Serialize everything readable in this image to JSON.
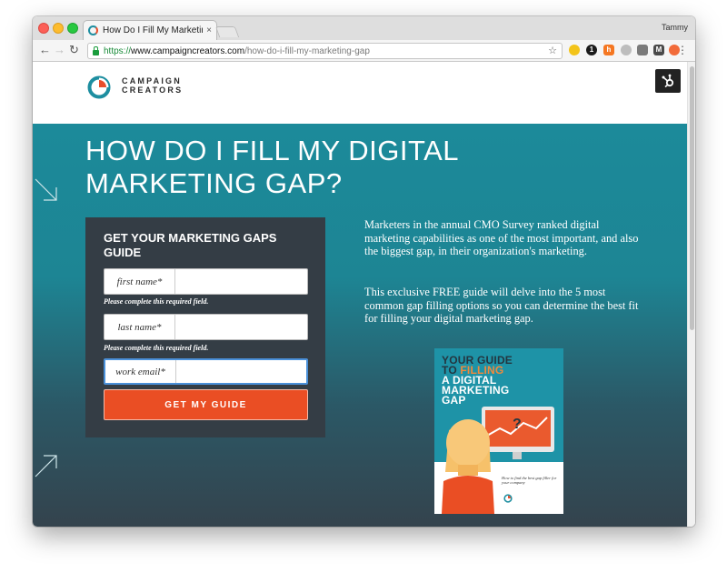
{
  "browser": {
    "tab_title": "How Do I Fill My Marketing Gap",
    "tab_close": "×",
    "profile_name": "Tammy",
    "url_scheme": "https://",
    "url_host": "www.campaigncreators.com",
    "url_path": "/how-do-i-fill-my-marketing-gap",
    "extension_icons": [
      "emoji-icon",
      "one-password-icon",
      "hubspot-sprocket-icon",
      "chrome-ext-icon",
      "bookmark-icon",
      "mixmax-icon",
      "hubspot-orange-icon"
    ]
  },
  "header": {
    "logo_line1": "CAMPAIGN",
    "logo_line2": "CREATORS",
    "brand_colors": {
      "teal": "#1d8ea0",
      "orange": "#e94e2b",
      "dark": "#2b2b2b"
    }
  },
  "hero": {
    "title": "HOW DO I FILL MY DIGITAL MARKETING GAP?"
  },
  "form": {
    "heading": "GET YOUR MARKETING GAPS GUIDE",
    "fields": [
      {
        "label": "first name*",
        "value": "",
        "error": "Please complete this required field."
      },
      {
        "label": "last name*",
        "value": "",
        "error": "Please complete this required field."
      },
      {
        "label": "work email*",
        "value": ""
      }
    ],
    "submit_label": "GET MY GUIDE",
    "submit_color": "#ea4e24"
  },
  "content": {
    "paragraph1": "Marketers in the annual CMO Survey ranked digital marketing capabilities as one of the most important, and also the biggest gap, in their organization's marketing.",
    "paragraph2": "This exclusive FREE guide will delve into the 5 most common gap filling options so you can determine the best fit for filling your digital marketing gap."
  },
  "book_cover": {
    "title_line1": "YOUR GUIDE",
    "title_line2a": "TO ",
    "title_line2b": "FILLING",
    "title_line3": "A DIGITAL",
    "title_line4": "MARKETING",
    "title_line5": "GAP",
    "question_mark": "?",
    "note": "How to find the best gap filler for your company"
  }
}
